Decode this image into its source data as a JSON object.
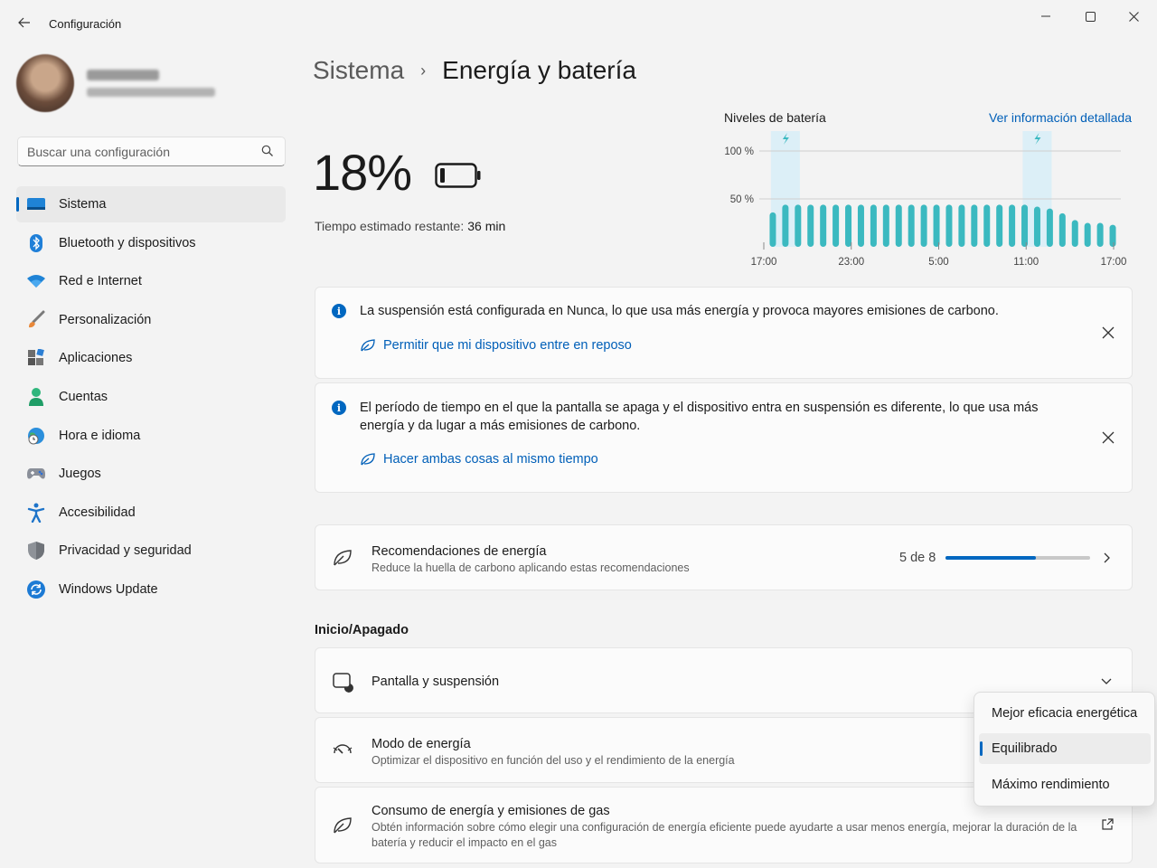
{
  "window": {
    "title": "Configuración"
  },
  "profile": {
    "name": "Luis Aguilar",
    "email": "luis.aguilar@outlook.com"
  },
  "search": {
    "placeholder": "Buscar una configuración"
  },
  "sidebar": {
    "items": [
      {
        "label": "Sistema",
        "icon": "system-icon"
      },
      {
        "label": "Bluetooth y dispositivos",
        "icon": "bluetooth-icon"
      },
      {
        "label": "Red e Internet",
        "icon": "wifi-icon"
      },
      {
        "label": "Personalización",
        "icon": "brush-icon"
      },
      {
        "label": "Aplicaciones",
        "icon": "apps-icon"
      },
      {
        "label": "Cuentas",
        "icon": "person-icon"
      },
      {
        "label": "Hora e idioma",
        "icon": "globe-clock-icon"
      },
      {
        "label": "Juegos",
        "icon": "gamepad-icon"
      },
      {
        "label": "Accesibilidad",
        "icon": "accessibility-icon"
      },
      {
        "label": "Privacidad y seguridad",
        "icon": "shield-icon"
      },
      {
        "label": "Windows Update",
        "icon": "update-icon"
      }
    ],
    "active_index": 0
  },
  "breadcrumb": {
    "parent": "Sistema",
    "separator": "›",
    "current": "Energía y batería"
  },
  "battery": {
    "percent": "18%",
    "remaining_label": "Tiempo estimado restante:",
    "remaining_value": "36 min"
  },
  "battery_chart": {
    "title": "Niveles de batería",
    "link": "Ver información detallada"
  },
  "chart_data": {
    "type": "bar",
    "ylabels": [
      "100 %",
      "50 %"
    ],
    "xlabels": [
      "17:00",
      "23:00",
      "5:00",
      "11:00",
      "17:00"
    ],
    "ylim": [
      0,
      100
    ],
    "values": [
      36,
      44,
      44,
      44,
      44,
      44,
      44,
      44,
      44,
      44,
      44,
      44,
      44,
      44,
      44,
      44,
      44,
      44,
      44,
      44,
      44,
      42,
      40,
      35,
      28,
      25,
      25,
      23
    ],
    "charging_bars": [
      1,
      21
    ],
    "bar_color": "#3bb9c0",
    "highlight_color": "#dceff7"
  },
  "notices": [
    {
      "text": "La suspensión está configurada en Nunca, lo que usa más energía y provoca mayores emisiones de carbono.",
      "action": "Permitir que mi dispositivo entre en reposo"
    },
    {
      "text": "El período de tiempo en el que la pantalla se apaga y el dispositivo entra en suspensión es diferente, lo que usa más energía y da lugar a más emisiones de carbono.",
      "action": "Hacer ambas cosas al mismo tiempo"
    }
  ],
  "recommendations": {
    "title": "Recomendaciones de energía",
    "desc": "Reduce la huella de carbono aplicando estas recomendaciones",
    "progress_label": "5 de 8",
    "progress_fraction": 0.625
  },
  "section": {
    "title": "Inicio/Apagado"
  },
  "rows": {
    "screen": {
      "title": "Pantalla y suspensión"
    },
    "power_mode": {
      "title": "Modo de energía",
      "desc": "Optimizar el dispositivo en función del uso y el rendimiento de la energía"
    },
    "consumption": {
      "title": "Consumo de energía y emisiones de gas",
      "desc": "Obtén información sobre cómo elegir una configuración de energía eficiente puede ayudarte a usar menos energía, mejorar la duración de la batería y reducir el impacto en el gas"
    }
  },
  "power_mode_dropdown": {
    "options": [
      "Mejor eficacia energética",
      "Equilibrado",
      "Máximo rendimiento"
    ],
    "selected_index": 1
  },
  "colors": {
    "accent": "#0067c0",
    "link": "#005fb8"
  }
}
